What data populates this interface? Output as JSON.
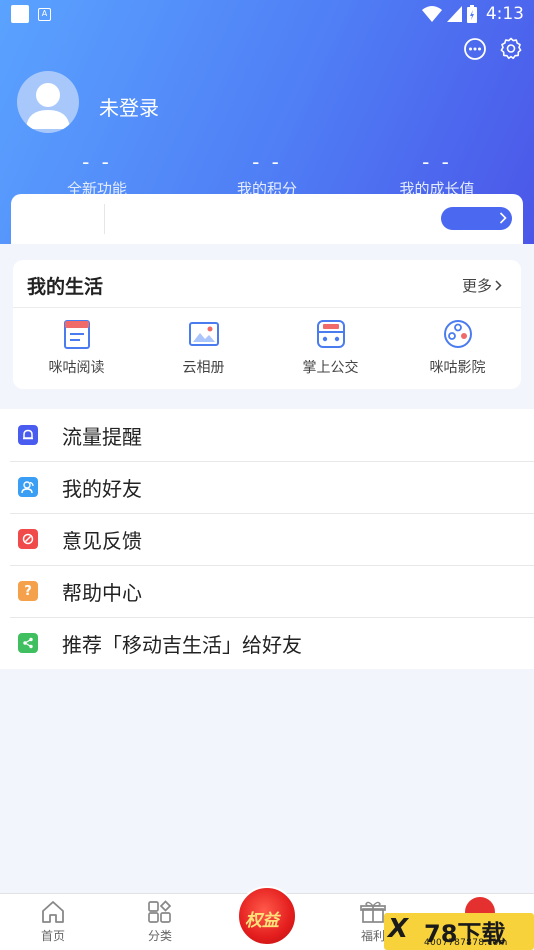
{
  "status_bar": {
    "time": "4:13"
  },
  "profile": {
    "login_text": "未登录"
  },
  "stats": [
    {
      "value": "- -",
      "label": "全新功能"
    },
    {
      "value": "- -",
      "label": "我的积分"
    },
    {
      "value": "- -",
      "label": "我的成长值"
    }
  ],
  "my_life": {
    "title": "我的生活",
    "more_label": "更多",
    "items": [
      {
        "label": "咪咕阅读",
        "icon": "book-icon"
      },
      {
        "label": "云相册",
        "icon": "photo-album-icon"
      },
      {
        "label": "掌上公交",
        "icon": "bus-icon"
      },
      {
        "label": "咪咕影院",
        "icon": "film-reel-icon"
      }
    ]
  },
  "menu": [
    {
      "label": "流量提醒",
      "icon": "bell-icon",
      "color": "#4a5cf0"
    },
    {
      "label": "我的好友",
      "icon": "friends-icon",
      "color": "#3a9ef5"
    },
    {
      "label": "意见反馈",
      "icon": "feedback-icon",
      "color": "#f04a4a"
    },
    {
      "label": "帮助中心",
      "icon": "question-icon",
      "color": "#f5a04a"
    },
    {
      "label": "推荐「移动吉生活」给好友",
      "icon": "share-icon",
      "color": "#3fbf5f"
    }
  ],
  "tabbar": [
    {
      "label": "首页",
      "icon": "home-icon"
    },
    {
      "label": "分类",
      "icon": "category-icon"
    },
    {
      "label": "权益",
      "icon": "benefits-icon"
    },
    {
      "label": "福利",
      "icon": "gift-icon"
    }
  ],
  "watermark": {
    "logo": "X",
    "number": "78下载",
    "url": "4007787878.com"
  }
}
